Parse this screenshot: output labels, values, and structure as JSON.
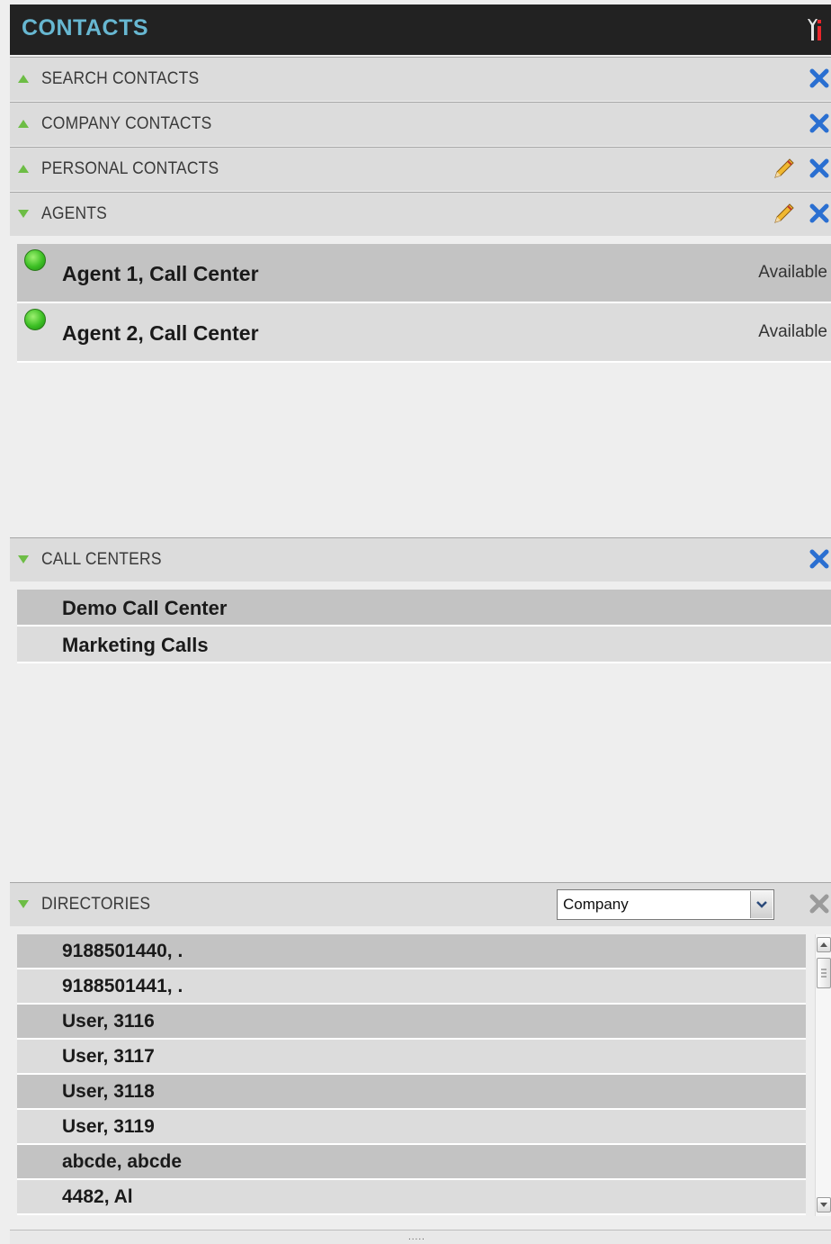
{
  "header": {
    "title": "CONTACTS",
    "tools_icon": "tools-icon"
  },
  "sections": {
    "search": {
      "label": "SEARCH CONTACTS",
      "expanded": false
    },
    "company": {
      "label": "COMPANY CONTACTS",
      "expanded": false
    },
    "personal": {
      "label": "PERSONAL CONTACTS",
      "expanded": false
    },
    "agents": {
      "label": "AGENTS",
      "expanded": true
    },
    "call_centers": {
      "label": "CALL CENTERS",
      "expanded": true
    },
    "directories": {
      "label": "DIRECTORIES",
      "expanded": true,
      "select_value": "Company"
    }
  },
  "agents": [
    {
      "name": "Agent 1, Call Center",
      "status": "Available"
    },
    {
      "name": "Agent 2, Call Center",
      "status": "Available"
    }
  ],
  "call_centers": [
    {
      "name": "Demo Call Center"
    },
    {
      "name": "Marketing Calls"
    }
  ],
  "directory_entries": [
    {
      "name": "9188501440, ."
    },
    {
      "name": "9188501441, ."
    },
    {
      "name": "User, 3116"
    },
    {
      "name": "User, 3117"
    },
    {
      "name": "User, 3118"
    },
    {
      "name": "User, 3119"
    },
    {
      "name": "abcde, abcde"
    },
    {
      "name": "4482, Al"
    }
  ],
  "colors": {
    "title": "#67b7d1",
    "arrow": "#6dbd45",
    "close": "#2a6fd1",
    "status_dot": "#3cbf24"
  },
  "footer": {
    "grip": "....."
  }
}
